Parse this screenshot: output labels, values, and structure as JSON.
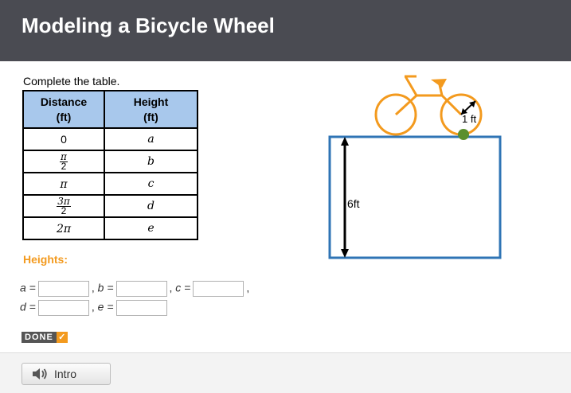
{
  "header": {
    "title": "Modeling a Bicycle Wheel"
  },
  "instructions": "Complete the table.",
  "table": {
    "headers": {
      "distance_line1": "Distance",
      "distance_line2": "(ft)",
      "height_line1": "Height",
      "height_line2": "(ft)"
    },
    "rows": [
      {
        "distance_text": "0",
        "height": "a"
      },
      {
        "distance_num": "π",
        "distance_den": "2",
        "height": "b"
      },
      {
        "distance_text": "π",
        "height": "c"
      },
      {
        "distance_num": "3π",
        "distance_den": "2",
        "height": "d"
      },
      {
        "distance_text": "2π",
        "height": "e"
      }
    ]
  },
  "heights": {
    "label": "Heights:",
    "a": "a =",
    "b": "b =",
    "c": "c =",
    "d": "d =",
    "e": "e =",
    "comma": ","
  },
  "done_button": {
    "label": "DONE",
    "check": "✓"
  },
  "diagram": {
    "radius_label": "1 ft",
    "height_label": "6ft"
  },
  "footer": {
    "intro_label": "Intro"
  },
  "colors": {
    "header": "#4a4b52",
    "table_header": "#a8c8ec",
    "accent": "#f39a1e",
    "box": "#2f74b5",
    "point": "#5a8f2e",
    "bike": "#f39a1e"
  }
}
